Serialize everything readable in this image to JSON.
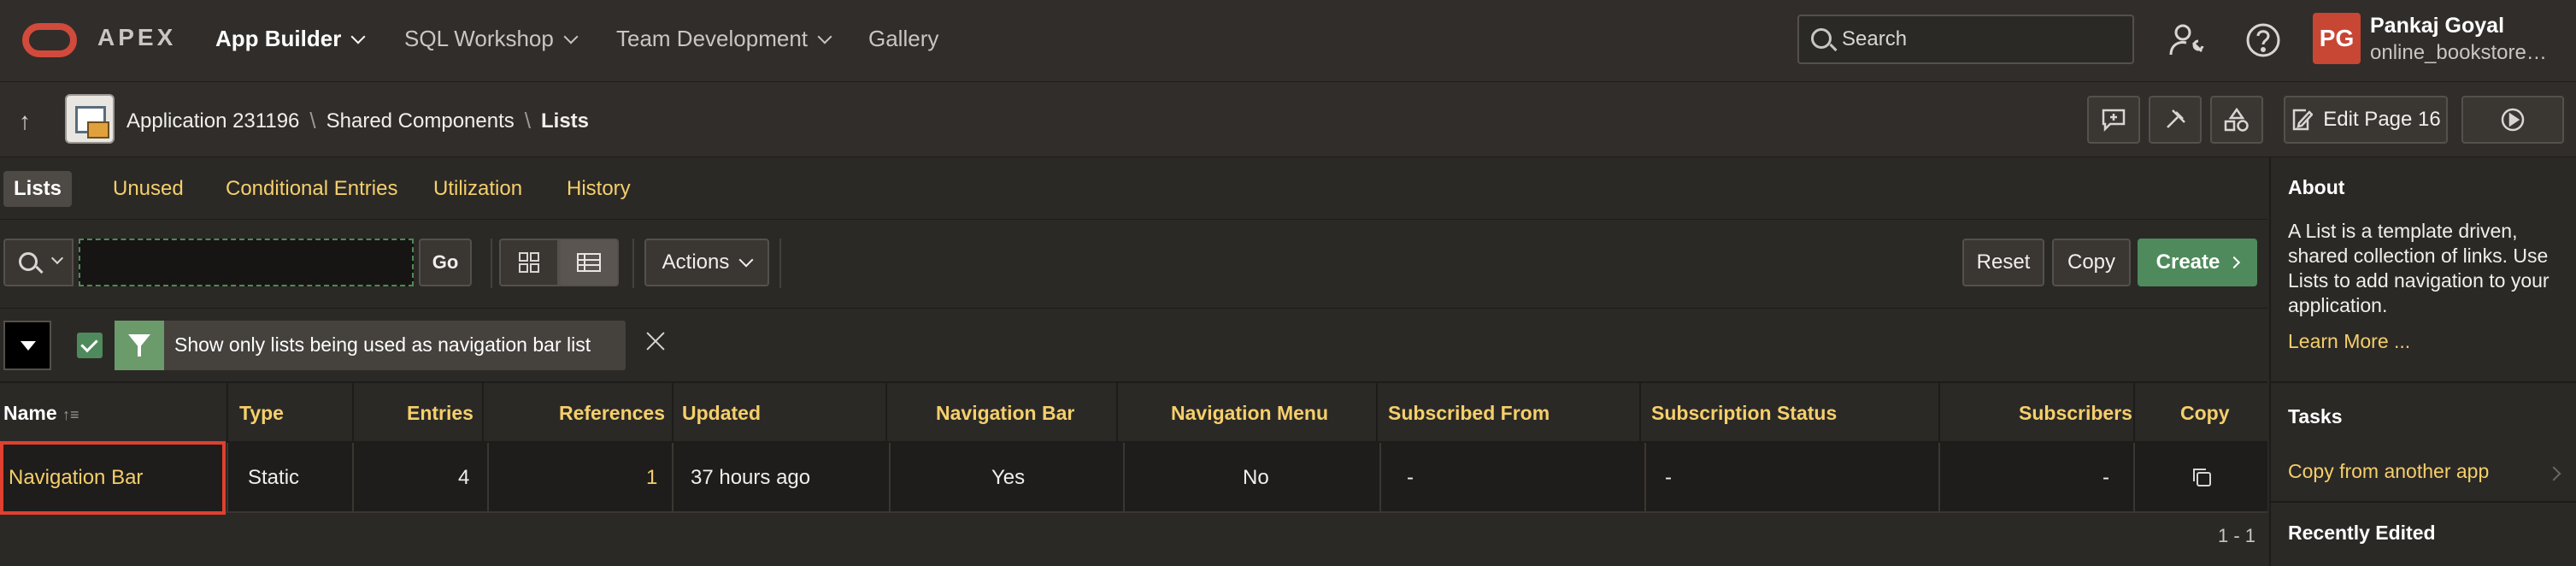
{
  "header": {
    "brand": "APEX",
    "nav": [
      {
        "label": "App Builder",
        "active": true
      },
      {
        "label": "SQL Workshop"
      },
      {
        "label": "Team Development"
      },
      {
        "label": "Gallery"
      }
    ],
    "search_placeholder": "Search",
    "user_initials": "PG",
    "user_name": "Pankaj Goyal",
    "user_workspace": "online_bookstore_app",
    "avatar_color": "#c74634"
  },
  "breadcrumb": {
    "items": [
      "Application 231196",
      "Shared Components",
      "Lists"
    ],
    "edit_page_label": "Edit Page 16"
  },
  "tabs": [
    "Lists",
    "Unused",
    "Conditional Entries",
    "Utilization",
    "History"
  ],
  "toolbar": {
    "search_value": "",
    "go_label": "Go",
    "actions_label": "Actions",
    "reset_label": "Reset",
    "copy_label": "Copy",
    "create_label": "Create",
    "create_color": "#4f8a5c"
  },
  "filter": {
    "enabled": true,
    "text": "Show only lists being used as navigation bar list"
  },
  "table": {
    "columns": [
      "Name",
      "Type",
      "Entries",
      "References",
      "Updated",
      "Navigation Bar",
      "Navigation Menu",
      "Subscribed From",
      "Subscription Status",
      "Subscribers",
      "Copy"
    ],
    "rows": [
      {
        "name": "Navigation Bar",
        "type": "Static",
        "entries": "4",
        "references": "1",
        "updated": "37 hours ago",
        "navigation_bar": "Yes",
        "navigation_menu": "No",
        "subscribed_from": "-",
        "subscription_status": "-",
        "subscribers": "-"
      }
    ],
    "pagination": "1 - 1"
  },
  "side_panel": {
    "about_title": "About",
    "about_text": "A List is a template driven, shared collection of links. Use Lists to add navigation to your application.",
    "learn_more": "Learn More ...",
    "tasks_title": "Tasks",
    "task_items": [
      "Copy from another app"
    ],
    "recent_title": "Recently Edited"
  },
  "colors": {
    "link": "#f5cf6b",
    "highlight_border": "#e0402f"
  }
}
